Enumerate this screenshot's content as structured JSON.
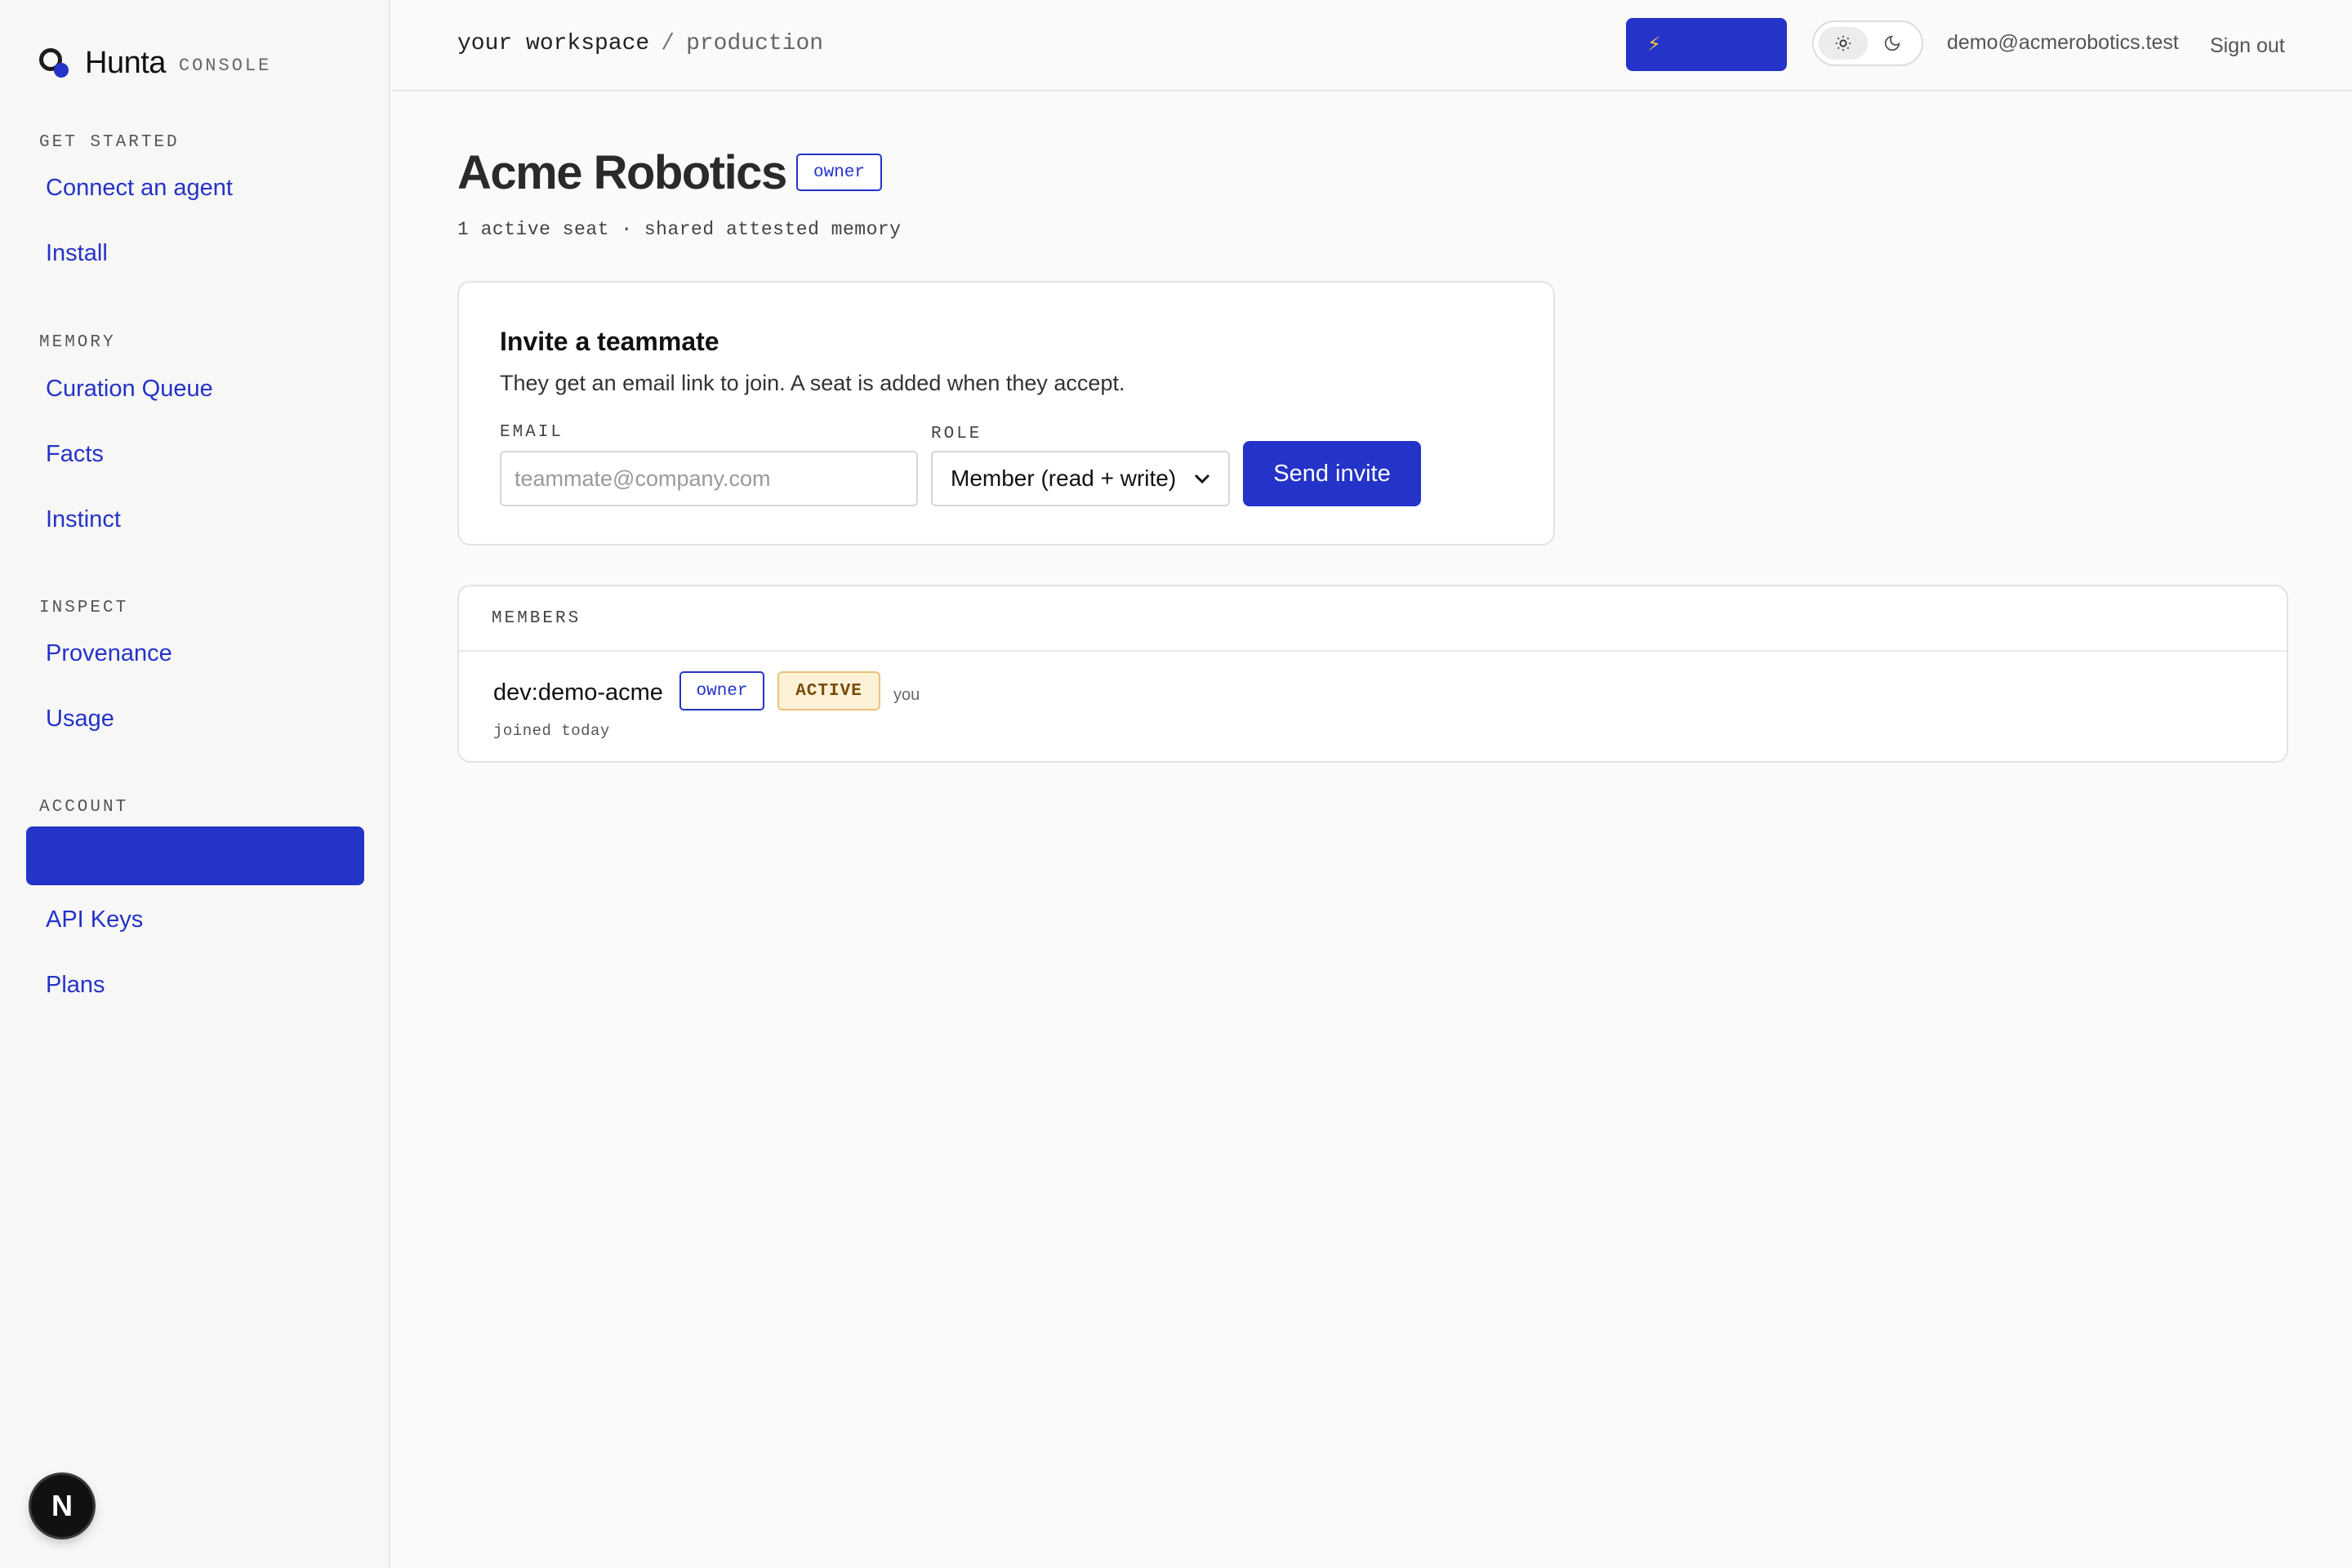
{
  "brand": {
    "name": "Hunta",
    "sub": "CONSOLE"
  },
  "sidebar": {
    "sections": [
      {
        "heading": "GET STARTED",
        "items": [
          "Connect an agent",
          "Install"
        ]
      },
      {
        "heading": "MEMORY",
        "items": [
          "Curation Queue",
          "Facts",
          "Instinct"
        ]
      },
      {
        "heading": "INSPECT",
        "items": [
          "Provenance",
          "Usage"
        ]
      },
      {
        "heading": "ACCOUNT",
        "items": [
          "",
          "API Keys",
          "Plans"
        ]
      }
    ],
    "active_item": ""
  },
  "topbar": {
    "workspace": "your workspace",
    "separator": "/",
    "environment": "production",
    "upgrade_icon": "⚡",
    "upgrade_label": "",
    "user_email": "demo@acmerobotics.test",
    "signout_label": "Sign out"
  },
  "page": {
    "title": "Acme Robotics",
    "role_badge": "owner",
    "subtitle": "1 active seat · shared attested memory"
  },
  "invite": {
    "title": "Invite a teammate",
    "description": "They get an email link to join. A seat is added when they accept.",
    "email_label": "EMAIL",
    "email_placeholder": "teammate@company.com",
    "email_value": "",
    "role_label": "ROLE",
    "role_value": "Member (read + write)",
    "send_label": "Send invite"
  },
  "members": {
    "heading": "MEMBERS",
    "rows": [
      {
        "name": "dev:demo-acme",
        "role": "owner",
        "status": "ACTIVE",
        "note": "you",
        "joined": "joined today"
      }
    ]
  },
  "colors": {
    "accent": "#2433c8",
    "active_badge_bg": "#fdf1d8",
    "active_badge_text": "#7a4a00"
  },
  "misc": {
    "framework_badge": "N"
  }
}
